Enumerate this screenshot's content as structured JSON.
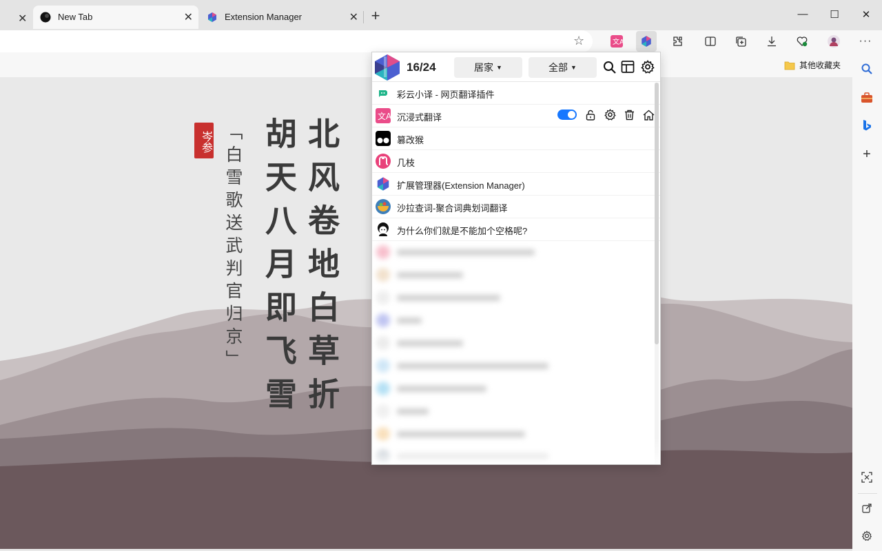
{
  "tabs": [
    {
      "title": "New Tab",
      "close": "✕"
    },
    {
      "title": "Extension Manager",
      "close": "✕"
    }
  ],
  "tabstrip": {
    "stub_close": "✕",
    "new_tab": "+"
  },
  "window": {
    "minimize": "—",
    "maximize": "☐",
    "close": "✕"
  },
  "toolbar": {
    "star": "☆",
    "icons": [
      "immersive-translate-icon",
      "extension-manager-icon",
      "extensions-puzzle-icon",
      "split-screen-icon",
      "collections-icon",
      "downloads-icon",
      "browser-essentials-icon",
      "profile-icon",
      "more-icon"
    ],
    "more": "···"
  },
  "favorites": {
    "folder_label": "其他收藏夹"
  },
  "poem": {
    "col1": "北风卷地白草折",
    "col2": "胡天八月即飞雪",
    "title": "「白雪歌送武判官归京」",
    "author": "岑参"
  },
  "popup": {
    "count": "16/24",
    "group_filter": "居家",
    "type_filter": "全部",
    "extensions": [
      {
        "name": "彩云小译 - 网页翻译插件",
        "icon": "caiyun-icon",
        "color": "#1fb58a"
      },
      {
        "name": "沉浸式翻译",
        "icon": "immersive-translate-icon",
        "color": "#ea4c89"
      },
      {
        "name": "篡改猴",
        "icon": "tampermonkey-icon",
        "color": "#000000"
      },
      {
        "name": "几枝",
        "icon": "jizhi-icon",
        "color": "#e9417a"
      },
      {
        "name": "扩展管理器(Extension Manager)",
        "icon": "extension-manager-icon",
        "color": "#4b5fd1"
      },
      {
        "name": "沙拉查词-聚合词典划词翻译",
        "icon": "saladict-icon",
        "color": "#f5b335"
      },
      {
        "name": "为什么你们就是不能加个空格呢?",
        "icon": "pangu-icon",
        "color": "#111111"
      }
    ],
    "blurred_rows": 10
  },
  "colors": {
    "accent": "#1677ff",
    "tab_active": "#f7f7f7",
    "tabstrip": "#e4e4e4",
    "seal": "#c8302e"
  }
}
